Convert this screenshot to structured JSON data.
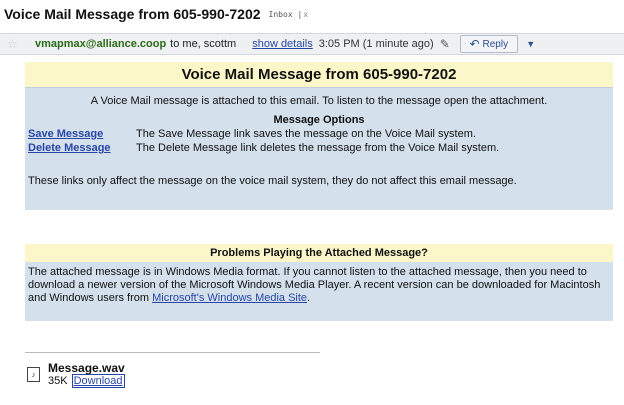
{
  "header": {
    "subject": "Voice Mail Message from 605-990-7202",
    "label": "Inbox",
    "label_close": "x"
  },
  "sender": {
    "from": "vmapmax@alliance.coop",
    "recipients": "to me, scottm",
    "show_details": "show details",
    "time": "3:05 PM (1 minute ago)",
    "reply_label": "Reply"
  },
  "message": {
    "title": "Voice Mail Message from 605-990-7202",
    "intro": "A Voice Mail message is attached to this email. To listen to the message open the attachment.",
    "options_heading": "Message Options",
    "options": [
      {
        "link": "Save Message",
        "desc": "The Save Message link saves the message on the Voice Mail system."
      },
      {
        "link": "Delete Message",
        "desc": "The Delete Message link deletes the message from the Voice Mail system."
      }
    ],
    "note": "These links only affect the message on the voice mail system, they do not affect this email message."
  },
  "problems": {
    "title": "Problems Playing the Attached Message?",
    "body": "The attached message is in Windows Media format. If you cannot listen to the attached message, then you need to download a newer version of the Microsoft Windows Media Player. A recent version can be downloaded for Macintosh and Windows users from",
    "link": "Microsoft's Windows Media Site",
    "tail": "."
  },
  "attachment": {
    "name": "Message.wav",
    "size": "35K",
    "download": "Download"
  }
}
